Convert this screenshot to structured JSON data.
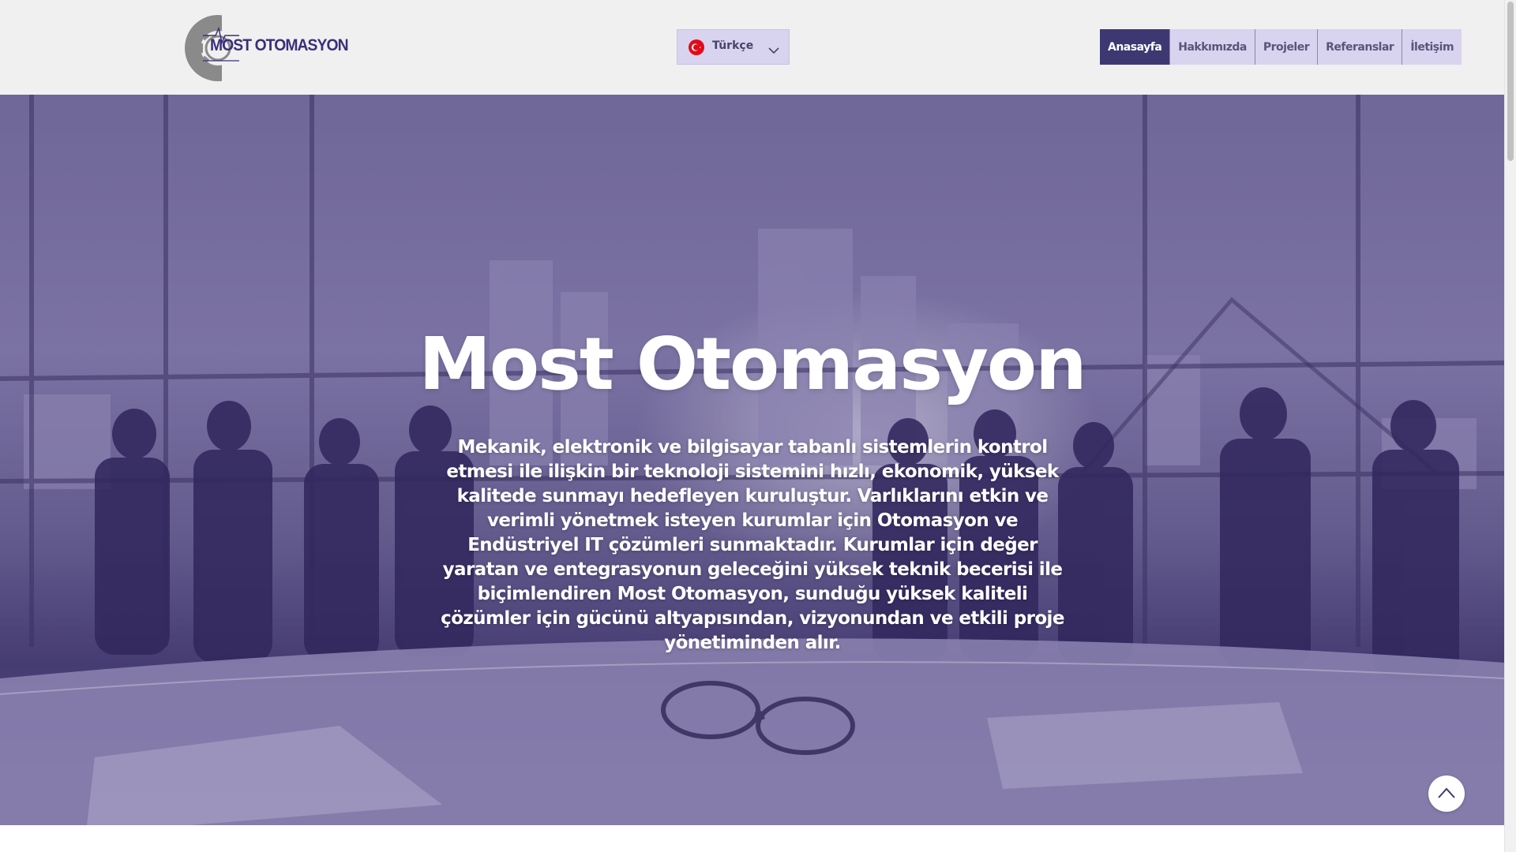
{
  "header": {
    "logo_text": "MOST OTOMASYON",
    "language": {
      "selected": "Türkçe",
      "flag": "turkey-flag-icon"
    },
    "nav": [
      {
        "label": "Anasayfa",
        "active": true
      },
      {
        "label": "Hakkımızda",
        "active": false
      },
      {
        "label": "Projeler",
        "active": false
      },
      {
        "label": "Referanslar",
        "active": false
      },
      {
        "label": "İletişim",
        "active": false
      }
    ]
  },
  "hero": {
    "title": "Most Otomasyon",
    "description": "Mekanik, elektronik ve bilgisayar tabanlı sistemlerin kontrol etmesi ile ilişkin bir teknoloji sistemini hızlı, ekonomik, yüksek kalitede sunmayı hedefleyen kuruluştur. Varlıklarını etkin ve verimli yönetmek isteyen kurumlar için Otomasyon ve Endüstriyel IT çözümleri sunmaktadır. Kurumlar için değer yaratan ve entegrasyonun geleceğini yüksek teknik becerisi ile biçimlendiren Most Otomasyon, sunduğu yüksek kaliteli çözümler için gücünü altyapısından, vizyonundan ve etkili proje yönetiminden alır.",
    "scroll_top_icon": "chevron-up-icon"
  },
  "colors": {
    "accent": "#3e3872",
    "nav_bg": "#d8d3ef",
    "header_bg": "#f0f0f0",
    "logo": "#3b2f7a"
  }
}
